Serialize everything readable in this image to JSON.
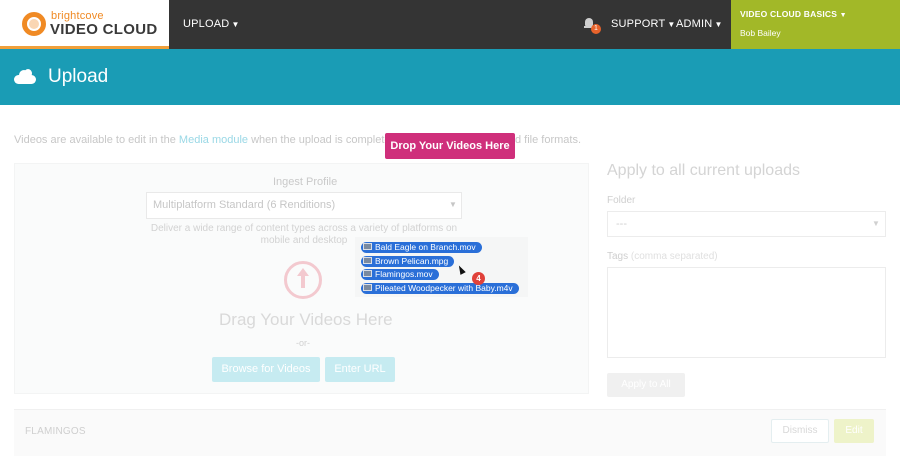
{
  "brand": {
    "sub": "brightcove",
    "main": "VIDEO CLOUD",
    "accent": "#f08a24"
  },
  "nav": {
    "upload": "UPLOAD",
    "support": "SUPPORT",
    "admin": "ADMIN",
    "notification_count": "1",
    "account_title": "VIDEO CLOUD BASICS",
    "account_user": "Bob Bailey",
    "account_color": "#a2b828"
  },
  "page": {
    "title": "Upload",
    "banner_color": "#1a9cb5"
  },
  "info": {
    "prefix": "Videos are available to edit in the ",
    "link": "Media module",
    "suffix": " when the upload is complete. Se",
    "tail": "d file formats."
  },
  "ingest": {
    "label": "Ingest Profile",
    "selected": "Multiplatform Standard (6 Renditions)",
    "description": "Deliver a wide range of content types across a variety of platforms on mobile and desktop"
  },
  "dropzone": {
    "title": "Drag Your Videos Here",
    "or": "-or-",
    "browse": "Browse for Videos",
    "enter_url": "Enter URL",
    "drop_button": "Drop Your Videos Here",
    "drop_color": "#cf2f7b"
  },
  "dragged_files": [
    {
      "name": "Bald Eagle on Branch.mov"
    },
    {
      "name": "Brown Pelican.mpg"
    },
    {
      "name": "Flamingos.mov"
    },
    {
      "name": "Pileated Woodpecker with Baby.m4v"
    }
  ],
  "dragged_count": "4",
  "apply": {
    "title": "Apply to all current uploads",
    "folder_label": "Folder",
    "folder_value": "---",
    "tags_label": "Tags",
    "tags_hint": "(comma separated)",
    "apply_button": "Apply to All"
  },
  "upload_row": {
    "name": "FLAMINGOS",
    "dismiss": "Dismiss",
    "edit": "Edit"
  }
}
